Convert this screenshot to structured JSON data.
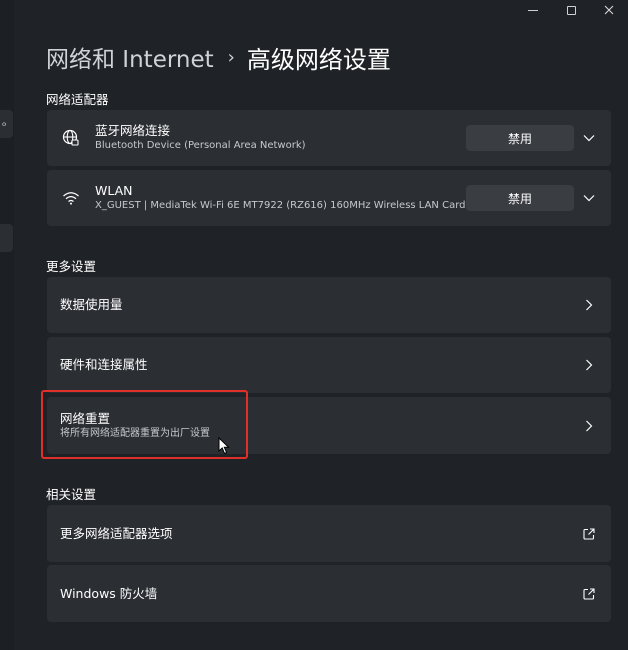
{
  "breadcrumb": {
    "parent": "网络和 Internet",
    "separator": "›",
    "current": "高级网络设置"
  },
  "sections": {
    "adapters_title": "网络适配器",
    "more_title": "更多设置",
    "related_title": "相关设置"
  },
  "adapters": [
    {
      "name": "蓝牙网络连接",
      "description": "Bluetooth Device (Personal Area Network)",
      "icon": "globe-ethernet-icon",
      "button": "禁用"
    },
    {
      "name": "WLAN",
      "description": "X_GUEST | MediaTek Wi-Fi 6E MT7922 (RZ616) 160MHz Wireless LAN Card",
      "icon": "wifi-icon",
      "button": "禁用"
    }
  ],
  "more_settings": [
    {
      "title": "数据使用量"
    },
    {
      "title": "硬件和连接属性"
    },
    {
      "title": "网络重置",
      "subtitle": "将所有网络适配器重置为出厂设置"
    }
  ],
  "related_settings": [
    {
      "title": "更多网络适配器选项"
    },
    {
      "title": "Windows 防火墙"
    }
  ],
  "colors": {
    "background": "#1f2226",
    "card": "#2b2e33",
    "highlight": "#e0302a"
  }
}
